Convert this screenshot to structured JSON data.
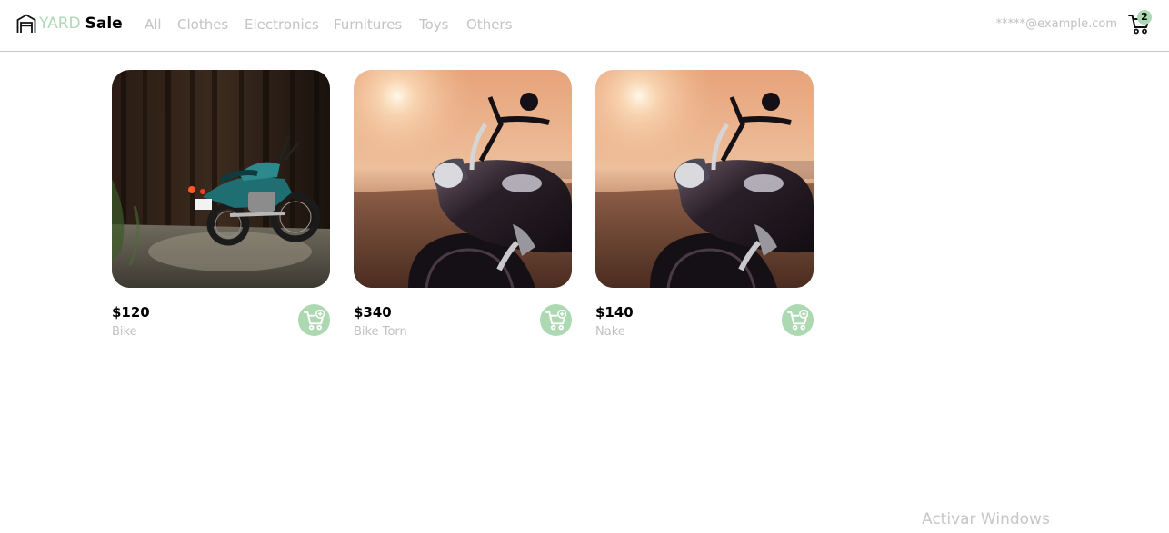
{
  "header": {
    "logo_part1": "YARD",
    "logo_part2": "Sale",
    "nav": [
      "All",
      "Clothes",
      "Electronics",
      "Furnitures",
      "Toys",
      "Others"
    ],
    "user_email": "*****@example.com",
    "cart_count": "2"
  },
  "products": [
    {
      "price": "$120",
      "name": "Bike",
      "image": "teal motorcycle parked by dark wooden wall"
    },
    {
      "price": "$340",
      "name": "Bike Torn",
      "image": "cruiser motorcycle at sunset in field"
    },
    {
      "price": "$140",
      "name": "Nake",
      "image": "cruiser motorcycle at sunset in field"
    }
  ],
  "watermark": "Activar Windows",
  "colors": {
    "accent_green": "#acd9b2",
    "nav_text": "#c4c4c4",
    "muted_text": "#c0c0c0",
    "divider": "#c8c8c8"
  },
  "icons": [
    "store-icon",
    "cart-icon",
    "add-to-cart-icon"
  ]
}
